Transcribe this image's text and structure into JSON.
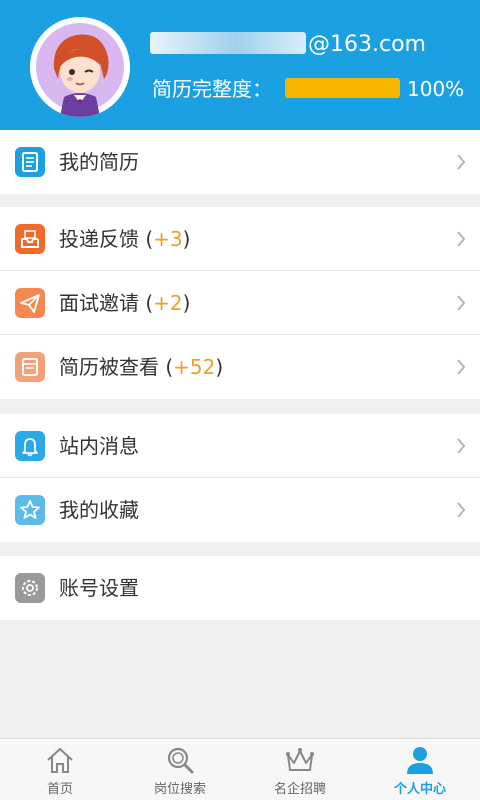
{
  "header": {
    "email_visible": "@163.com",
    "completeness_label": "简历完整度：",
    "completeness_value": "100%",
    "completeness_fraction": 1.0
  },
  "menu": {
    "group1": [
      {
        "label": "我的简历",
        "count": "",
        "icon": "resume-icon",
        "color": "#1ba0e1"
      }
    ],
    "group2": [
      {
        "label": "投递反馈 (",
        "count": "+3",
        "suffix": ")",
        "icon": "inbox-icon",
        "color": "#f06a2c"
      },
      {
        "label": "面试邀请 (",
        "count": "+2",
        "suffix": ")",
        "icon": "paper-plane-icon",
        "color": "#f5874f"
      },
      {
        "label": "简历被查看 (",
        "count": "+52",
        "suffix": ")",
        "icon": "viewed-resume-icon",
        "color": "#f6a07a"
      }
    ],
    "group3": [
      {
        "label": "站内消息",
        "count": "",
        "icon": "bell-icon",
        "color": "#2aa8e8"
      },
      {
        "label": "我的收藏",
        "count": "",
        "icon": "star-icon",
        "color": "#5cbbe9"
      }
    ],
    "group4": [
      {
        "label": "账号设置",
        "count": "",
        "icon": "gear-icon",
        "color": "#9a9a9a"
      }
    ]
  },
  "bottom_nav": {
    "items": [
      {
        "label": "首页",
        "icon": "home-icon"
      },
      {
        "label": "岗位搜索",
        "icon": "search-icon"
      },
      {
        "label": "名企招聘",
        "icon": "crown-icon"
      },
      {
        "label": "个人中心",
        "icon": "user-icon",
        "active": true
      }
    ]
  },
  "colors": {
    "header_bg": "#1ba0e1",
    "progress_fill": "#f7b500",
    "count_accent": "#f0a020",
    "active_tab": "#1ba0e1"
  }
}
